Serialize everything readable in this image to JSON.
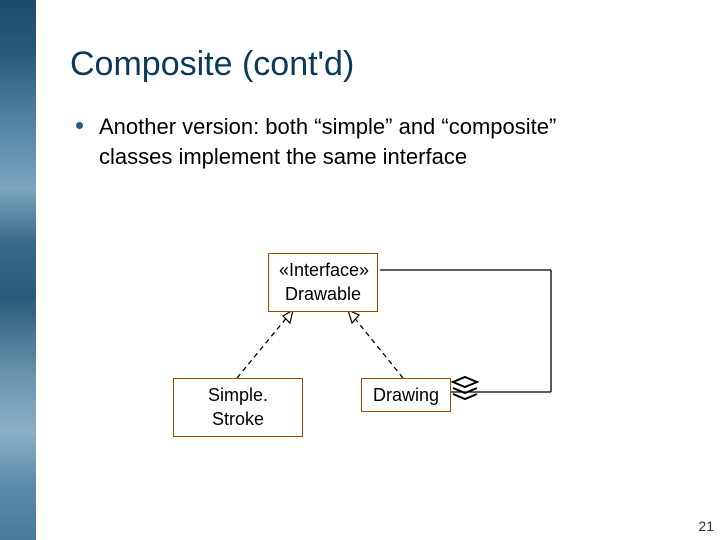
{
  "slide": {
    "title": "Composite (cont'd)",
    "bullet": "Another version: both “simple” and “composite” classes implement the same interface",
    "page_number": "21"
  },
  "diagram": {
    "interface_stereotype": "«Interface»",
    "interface_name": "Drawable",
    "simple_class": "Simple. Stroke",
    "composite_class": "Drawing",
    "icon": "stack-icon"
  }
}
